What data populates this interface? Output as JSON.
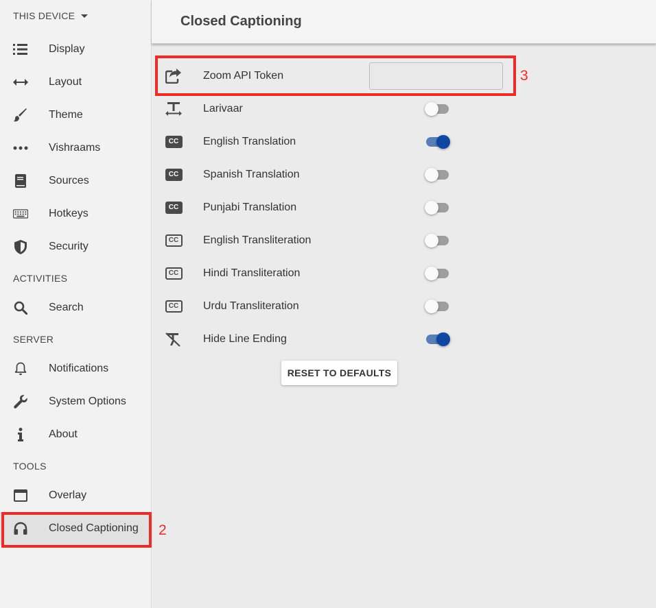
{
  "sidebar": {
    "device_header": "THIS DEVICE",
    "items": [
      {
        "label": "Display",
        "icon": "list-icon"
      },
      {
        "label": "Layout",
        "icon": "arrows-horizontal-icon"
      },
      {
        "label": "Theme",
        "icon": "brush-icon"
      },
      {
        "label": "Vishraams",
        "icon": "dots-icon"
      },
      {
        "label": "Sources",
        "icon": "book-icon"
      },
      {
        "label": "Hotkeys",
        "icon": "keyboard-icon"
      },
      {
        "label": "Security",
        "icon": "shield-icon"
      }
    ],
    "sections": {
      "activities": "ACTIVITIES",
      "server": "SERVER",
      "tools": "TOOLS"
    },
    "activities_items": [
      {
        "label": "Search",
        "icon": "search-icon"
      }
    ],
    "server_items": [
      {
        "label": "Notifications",
        "icon": "bell-icon"
      },
      {
        "label": "System Options",
        "icon": "wrench-icon"
      },
      {
        "label": "About",
        "icon": "info-icon"
      }
    ],
    "tools_items": [
      {
        "label": "Overlay",
        "icon": "overlay-icon"
      },
      {
        "label": "Closed Captioning",
        "icon": "headphones-icon",
        "active": true
      }
    ]
  },
  "main": {
    "title": "Closed Captioning",
    "zoom_token_label": "Zoom API Token",
    "zoom_token_value": "",
    "settings": [
      {
        "label": "Larivaar",
        "on": false
      },
      {
        "label": "English Translation",
        "on": true
      },
      {
        "label": "Spanish Translation",
        "on": false
      },
      {
        "label": "Punjabi Translation",
        "on": false
      },
      {
        "label": "English Transliteration",
        "on": false
      },
      {
        "label": "Hindi Transliteration",
        "on": false
      },
      {
        "label": "Urdu Transliteration",
        "on": false
      },
      {
        "label": "Hide Line Ending",
        "on": true
      }
    ],
    "reset_label": "RESET TO DEFAULTS",
    "cc_text": "CC"
  },
  "annotations": {
    "sidebar_marker": "2",
    "token_marker": "3"
  },
  "colors": {
    "annotation_red": "#ee2b24",
    "toggle_on": "#0d47a1",
    "toggle_off": "#9e9e9e"
  }
}
